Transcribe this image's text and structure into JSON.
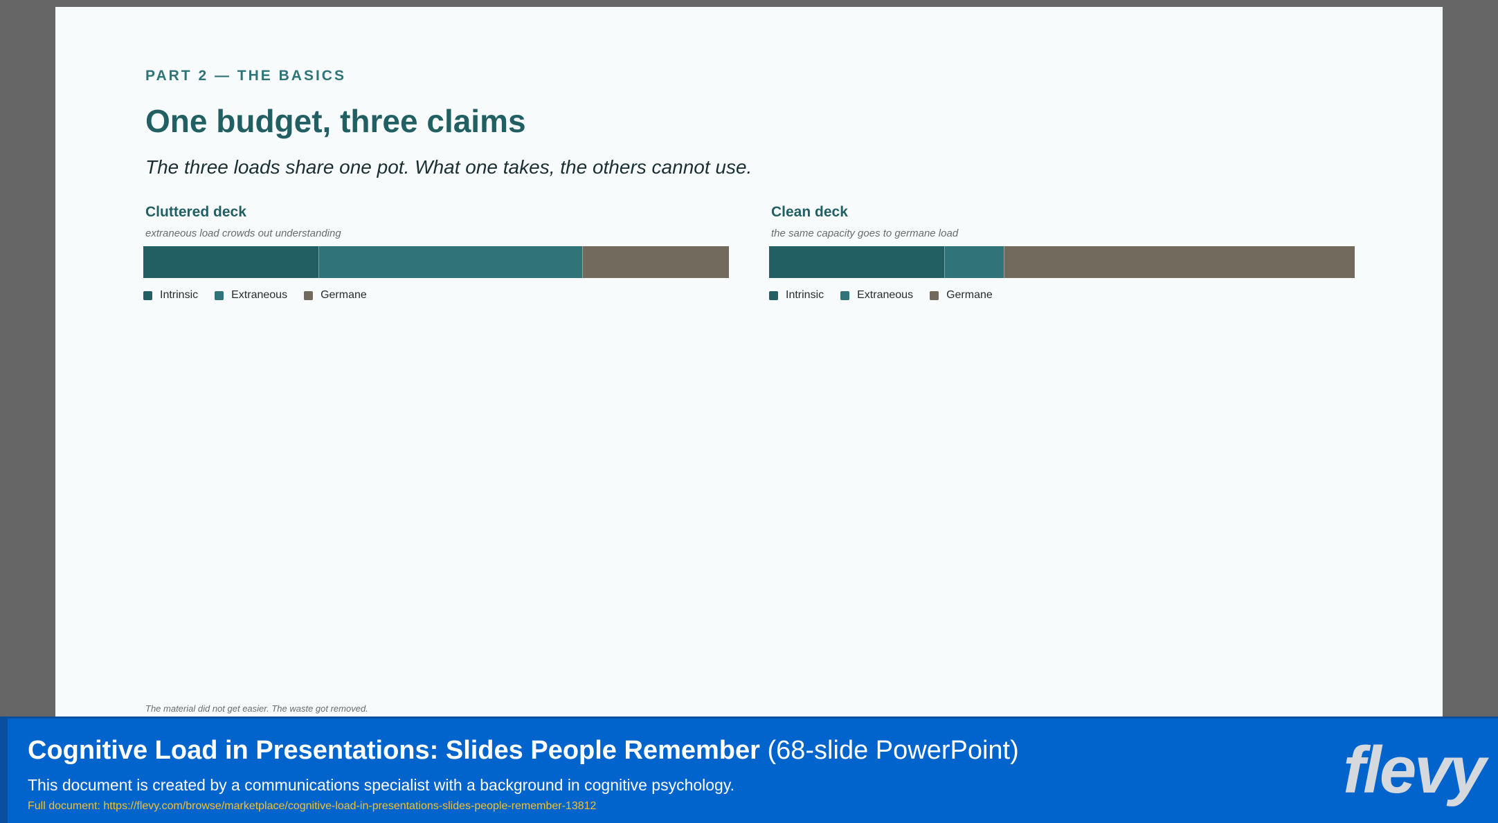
{
  "slide": {
    "kicker": "PART 2 — THE BASICS",
    "title": "One budget, three claims",
    "subtitle": "The three loads share one pot. What one takes, the others cannot use.",
    "footnote": "The material did not get easier. The waste got removed."
  },
  "chart_data": [
    {
      "type": "bar",
      "orientation": "horizontal-stacked",
      "title": "Cluttered deck",
      "subtitle": "extraneous load crowds out understanding",
      "categories": [
        "Cluttered deck"
      ],
      "series": [
        {
          "name": "Intrinsic",
          "values": [
            30
          ],
          "color": "#215f63"
        },
        {
          "name": "Extraneous",
          "values": [
            45
          ],
          "color": "#307479"
        },
        {
          "name": "Germane",
          "values": [
            25
          ],
          "color": "#736a5e"
        }
      ],
      "legend": [
        "Intrinsic",
        "Extraneous",
        "Germane"
      ],
      "legend_position": "bottom-left"
    },
    {
      "type": "bar",
      "orientation": "horizontal-stacked",
      "title": "Clean deck",
      "subtitle": "the same capacity goes to germane load",
      "categories": [
        "Clean deck"
      ],
      "series": [
        {
          "name": "Intrinsic",
          "values": [
            30
          ],
          "color": "#215f63"
        },
        {
          "name": "Extraneous",
          "values": [
            10
          ],
          "color": "#307479"
        },
        {
          "name": "Germane",
          "values": [
            60
          ],
          "color": "#736a5e"
        }
      ],
      "legend": [
        "Intrinsic",
        "Extraneous",
        "Germane"
      ],
      "legend_position": "bottom-left"
    }
  ],
  "banner": {
    "title_bold": "Cognitive Load in Presentations: Slides People Remember",
    "title_suffix": " (68-slide PowerPoint)",
    "description": "This document is created by a communications specialist with a background in cognitive psychology.",
    "link": "Full document: https://flevy.com/browse/marketplace/cognitive-load-in-presentations-slides-people-remember-13812",
    "logo": "flevy"
  }
}
